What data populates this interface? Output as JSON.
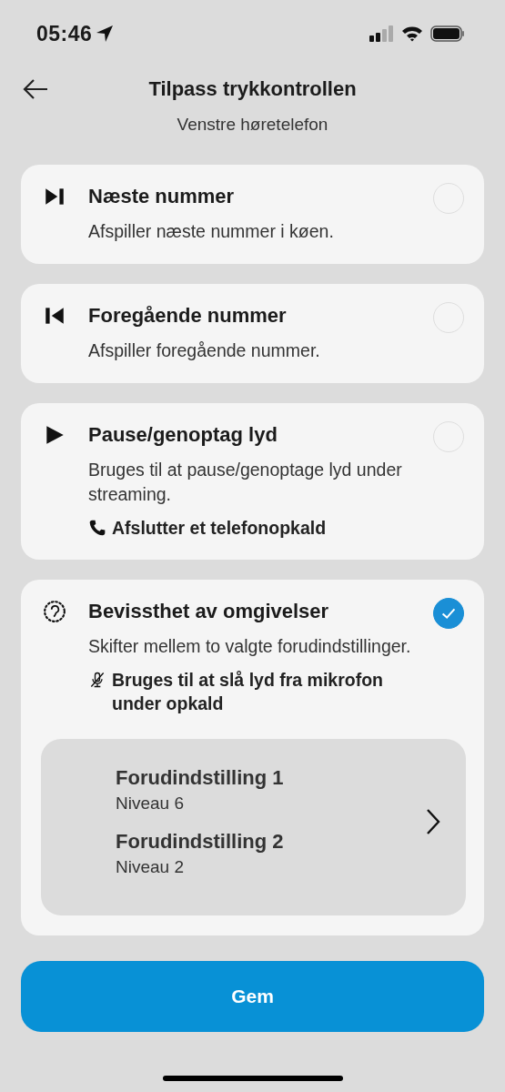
{
  "status_bar": {
    "time": "05:46"
  },
  "header": {
    "title": "Tilpass trykkontrollen",
    "subtitle": "Venstre høretelefon"
  },
  "options": [
    {
      "kind": "next",
      "title": "Næste nummer",
      "description": "Afspiller næste nummer i køen.",
      "selected": false
    },
    {
      "kind": "previous",
      "title": "Foregående nummer",
      "description": "Afspiller foregående nummer.",
      "selected": false
    },
    {
      "kind": "play",
      "title": "Pause/genoptag lyd",
      "description": "Bruges til at pause/genoptage lyd under streaming.",
      "selected": false,
      "note": {
        "kind": "phone",
        "text": "Afslutter et telefonopkald"
      }
    },
    {
      "kind": "ambient",
      "title": "Bevissthet av omgivelser",
      "description": "Skifter mellem to valgte forudindstillinger.",
      "selected": true,
      "note": {
        "kind": "mic-off",
        "text": "Bruges til at slå lyd fra mikrofon under opkald"
      },
      "presets": [
        {
          "name": "Forudindstilling 1",
          "value": "Niveau 6"
        },
        {
          "name": "Forudindstilling 2",
          "value": "Niveau 2"
        }
      ]
    }
  ],
  "save_button": "Gem"
}
